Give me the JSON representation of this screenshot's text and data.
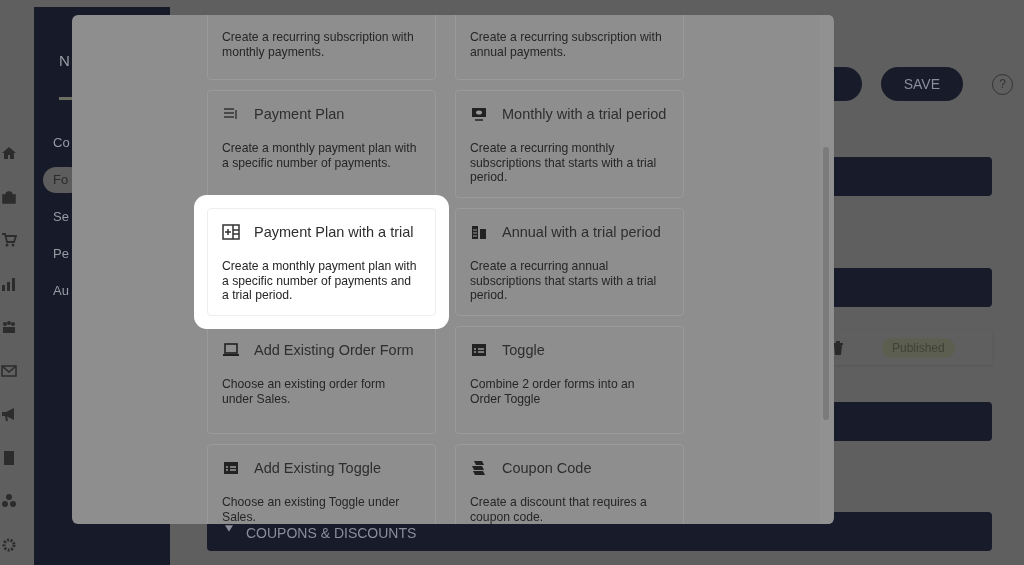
{
  "sidebar": {
    "title": "N",
    "items": [
      {
        "label": "Co",
        "selected": false
      },
      {
        "label": "Fo",
        "selected": true
      },
      {
        "label": "Se",
        "selected": false
      },
      {
        "label": "Pe",
        "selected": false
      },
      {
        "label": "Au",
        "selected": false
      }
    ]
  },
  "header": {
    "save_button": "SAVE",
    "help_button": "?"
  },
  "rows": [
    {
      "kind": "bar"
    },
    {
      "kind": "bar"
    },
    {
      "kind": "item",
      "status": "Published"
    },
    {
      "kind": "bar"
    },
    {
      "kind": "section",
      "label": "COUPONS & DISCOUNTS",
      "expanded": true
    }
  ],
  "modal": {
    "options": [
      {
        "description": "Create a recurring subscription with monthly payments.",
        "selected": false
      },
      {
        "description": "Create a recurring subscription with annual payments.",
        "selected": false
      },
      {
        "kind": "list",
        "title": "Payment Plan",
        "description": "Create a monthly payment plan with a specific number of payments.",
        "selected": false
      },
      {
        "kind": "monitor",
        "title": "Monthly with a trial period",
        "description": "Create a recurring monthly subscriptions that starts with a trial period.",
        "selected": false
      },
      {
        "kind": "grid",
        "title": "Payment Plan with a trial",
        "description": "Create a monthly payment plan with a specific number of payments and a trial period.",
        "selected": true
      },
      {
        "kind": "book",
        "title": "Annual with a trial period",
        "description": "Create a recurring annual subscriptions that starts with a trial period.",
        "selected": false
      },
      {
        "kind": "laptop",
        "title": "Add Existing Order Form",
        "description": "Choose an existing order form under Sales.",
        "selected": false
      },
      {
        "kind": "card",
        "title": "Toggle",
        "description": "Combine 2 order forms into an Order Toggle",
        "selected": false
      },
      {
        "kind": "card",
        "title": "Add Existing Toggle",
        "description": "Choose an existing Toggle under Sales.",
        "selected": false
      },
      {
        "kind": "coupon",
        "title": "Coupon Code",
        "description": "Create a discount that requires a coupon code.",
        "selected": false
      }
    ]
  }
}
